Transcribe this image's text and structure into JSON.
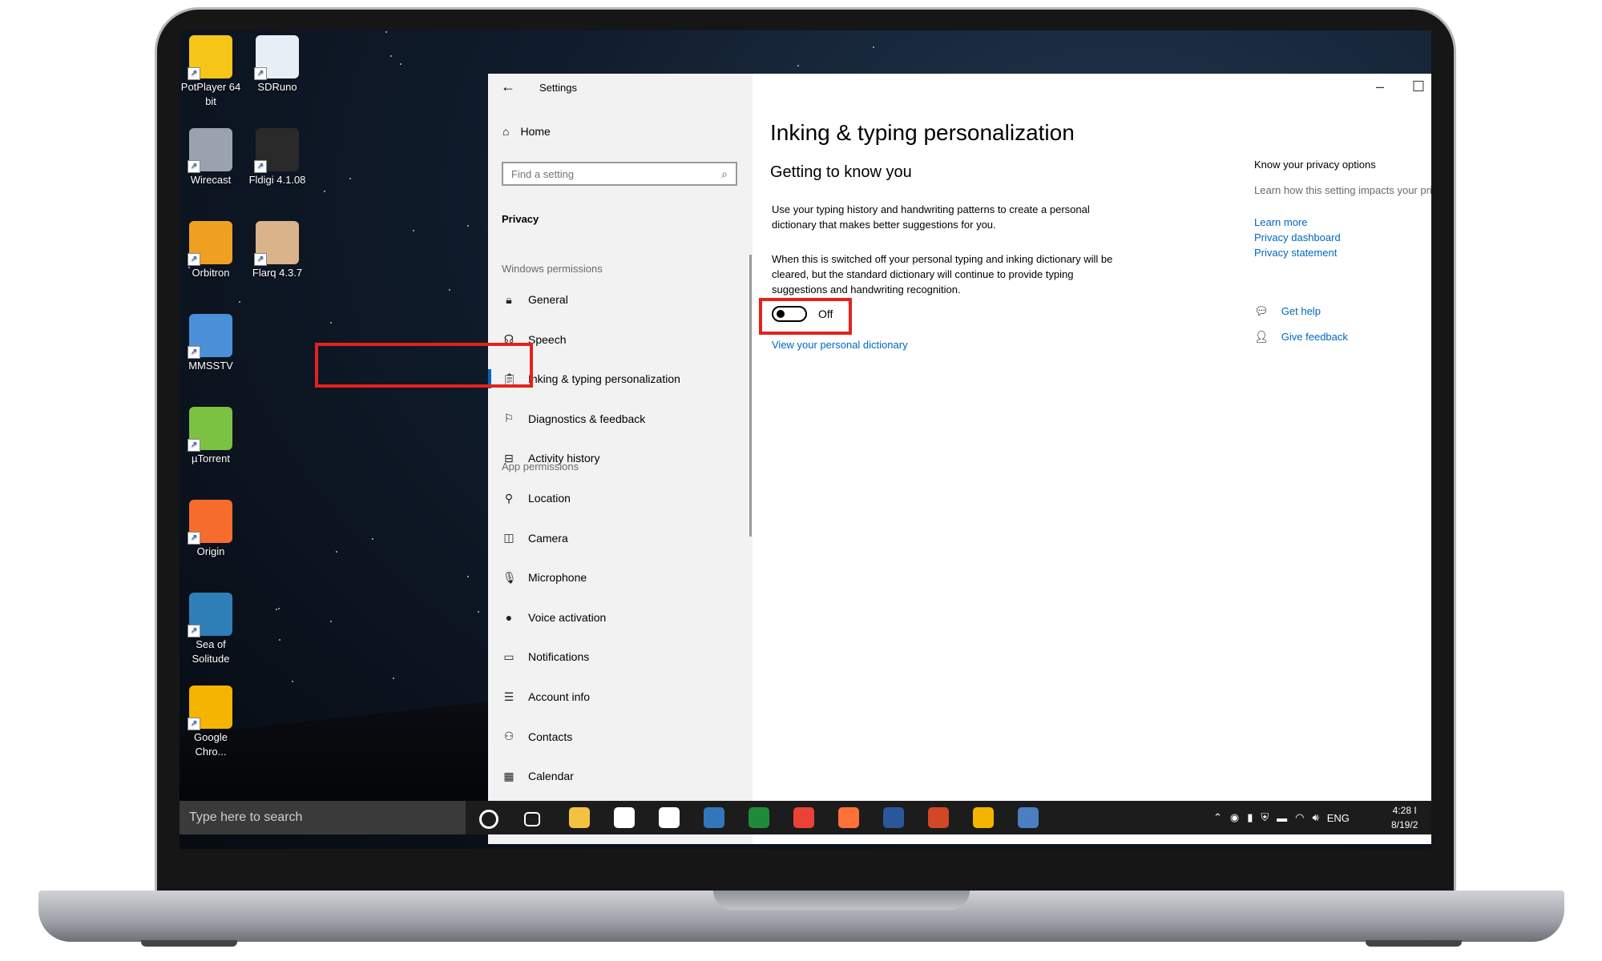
{
  "desktop": {
    "icons": [
      {
        "label": "PotPlayer 64 bit",
        "icon": "potplayer-icon",
        "color": "#f5c518"
      },
      {
        "label": "SDRuno",
        "icon": "sdruno-icon",
        "color": "#e8eef5"
      },
      {
        "label": "Wirecast",
        "icon": "wirecast-icon",
        "color": "#9aa3ad"
      },
      {
        "label": "Fldigi 4.1.08",
        "icon": "fldigi-icon",
        "color": "#2a2a2a"
      },
      {
        "label": "Orbitron",
        "icon": "orbitron-icon",
        "color": "#f0a020"
      },
      {
        "label": "Flarq 4.3.7",
        "icon": "flarq-icon",
        "color": "#d9b48a"
      },
      {
        "label": "MMSSTV",
        "icon": "mmsstv-icon",
        "color": "#4a90d9"
      },
      {
        "label": "µTorrent",
        "icon": "utorrent-icon",
        "color": "#7cc242"
      },
      {
        "label": "Origin",
        "icon": "origin-icon",
        "color": "#f56c2d"
      },
      {
        "label": "Sea of Solitude",
        "icon": "sea-of-solitude-icon",
        "color": "#2e7fb8"
      },
      {
        "label": "Google Chro...",
        "icon": "chrome-canary-icon",
        "color": "#f4b400"
      }
    ]
  },
  "window": {
    "title": "Settings",
    "back_icon": "back-arrow-icon",
    "controls": {
      "minimize": "–",
      "maximize": "☐",
      "close": "✕"
    }
  },
  "nav": {
    "home_label": "Home",
    "search_placeholder": "Find a setting",
    "category": "Privacy",
    "windows_permissions_label": "Windows permissions",
    "windows_items": [
      {
        "label": "General",
        "icon": "lock-icon",
        "glyph": "🔒︎"
      },
      {
        "label": "Speech",
        "icon": "speech-icon",
        "glyph": "☊"
      },
      {
        "label": "Inking & typing personalization",
        "icon": "clipboard-icon",
        "glyph": "📋︎",
        "active": true
      },
      {
        "label": "Diagnostics & feedback",
        "icon": "feedback-person-icon",
        "glyph": "⚐"
      },
      {
        "label": "Activity history",
        "icon": "timeline-icon",
        "glyph": "⊟"
      }
    ],
    "app_permissions_label": "App permissions",
    "app_items": [
      {
        "label": "Location",
        "icon": "location-icon",
        "glyph": "⚲"
      },
      {
        "label": "Camera",
        "icon": "camera-icon",
        "glyph": "◫"
      },
      {
        "label": "Microphone",
        "icon": "microphone-icon",
        "glyph": "🎙︎"
      },
      {
        "label": "Voice activation",
        "icon": "voice-activation-icon",
        "glyph": "●"
      },
      {
        "label": "Notifications",
        "icon": "notifications-icon",
        "glyph": "▭"
      },
      {
        "label": "Account info",
        "icon": "account-info-icon",
        "glyph": "☰"
      },
      {
        "label": "Contacts",
        "icon": "contacts-icon",
        "glyph": "⚇"
      },
      {
        "label": "Calendar",
        "icon": "calendar-icon",
        "glyph": "▦"
      }
    ]
  },
  "main": {
    "title": "Inking & typing personalization",
    "subtitle": "Getting to know you",
    "description": "Use your typing history and handwriting patterns to create a personal dictionary that makes better suggestions for you.",
    "warning": "When this is switched off your personal typing and inking dictionary will be cleared, but the standard dictionary will continue to provide typing suggestions and handwriting recognition.",
    "toggle_state": "Off",
    "toggle_on": false,
    "dictionary_link": "View your personal dictionary"
  },
  "side": {
    "heading": "Know your privacy options",
    "text": "Learn how this setting impacts your privacy.",
    "links": [
      "Learn more",
      "Privacy dashboard",
      "Privacy statement"
    ],
    "get_help": "Get help",
    "give_feedback": "Give feedback"
  },
  "taskbar": {
    "search_placeholder": "Type here to search",
    "pinned": [
      {
        "icon": "cortana-icon",
        "color": "#1c1c1c"
      },
      {
        "icon": "task-view-icon",
        "color": "#1c1c1c"
      },
      {
        "icon": "file-explorer-icon",
        "color": "#f3c240"
      },
      {
        "icon": "microsoft-store-icon",
        "color": "#ffffff"
      },
      {
        "icon": "mail-icon",
        "color": "#ffffff"
      },
      {
        "icon": "edge-legacy-icon",
        "color": "#3277bc"
      },
      {
        "icon": "xbox-icon",
        "color": "#1f8a3a"
      },
      {
        "icon": "chrome-icon",
        "color": "#ea4335"
      },
      {
        "icon": "firefox-icon",
        "color": "#ff7139"
      },
      {
        "icon": "word-icon",
        "color": "#2b579a"
      },
      {
        "icon": "powerpoint-icon",
        "color": "#d24726"
      },
      {
        "icon": "chrome-canary-icon",
        "color": "#f4b400"
      },
      {
        "icon": "remote-desktop-icon",
        "color": "#4a7fc1"
      }
    ],
    "language": "ENG",
    "time": "4:28 I",
    "date": "8/19/2"
  },
  "colors": {
    "accent": "#0067c0",
    "highlight_box": "#e3231b",
    "nav_bg": "#f2f2f2"
  }
}
